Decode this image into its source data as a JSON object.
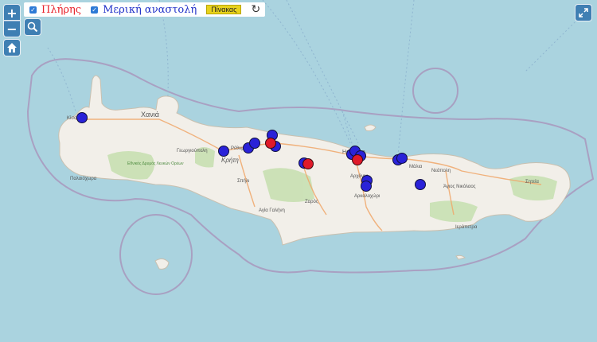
{
  "controls": {
    "zoom_in": "+",
    "zoom_out": "−",
    "search_icon": "search-icon",
    "home_icon": "home-icon",
    "fullscreen_icon": "fullscreen-icon"
  },
  "legend": {
    "full_label": "Πλήρης",
    "full_color": "#e8212a",
    "partial_label": "Μερική αναστολή",
    "partial_color": "#2030c8",
    "table_button": "Πίνακας",
    "refresh_icon": "refresh-icon"
  },
  "places": {
    "chania": "Χανιά",
    "kissamos": "Κίσσαμος",
    "georgioupoli": "Γεωργιούπολη",
    "rethymno": "Ρέθυμνο",
    "kriti": "Κρήτη",
    "paleochora": "Παλαιόχωρα",
    "spili": "Σπήλι",
    "agia_galini": "Αγία Γαλήνη",
    "zaros": "Ζαρός",
    "heraklion": "Ηράκλειο",
    "archanes": "Αρχάνες",
    "arkalochori": "Αρκαλοχώρι",
    "malia": "Μάλια",
    "neapoli": "Νεάπολη",
    "agios_nikolaos": "Άγιος Νικόλαος",
    "sitia": "Σητεία",
    "ierapetra": "Ιεράπετρα",
    "national_park": "Εθνικός Δρυμός Λευκών Ορέων"
  }
}
